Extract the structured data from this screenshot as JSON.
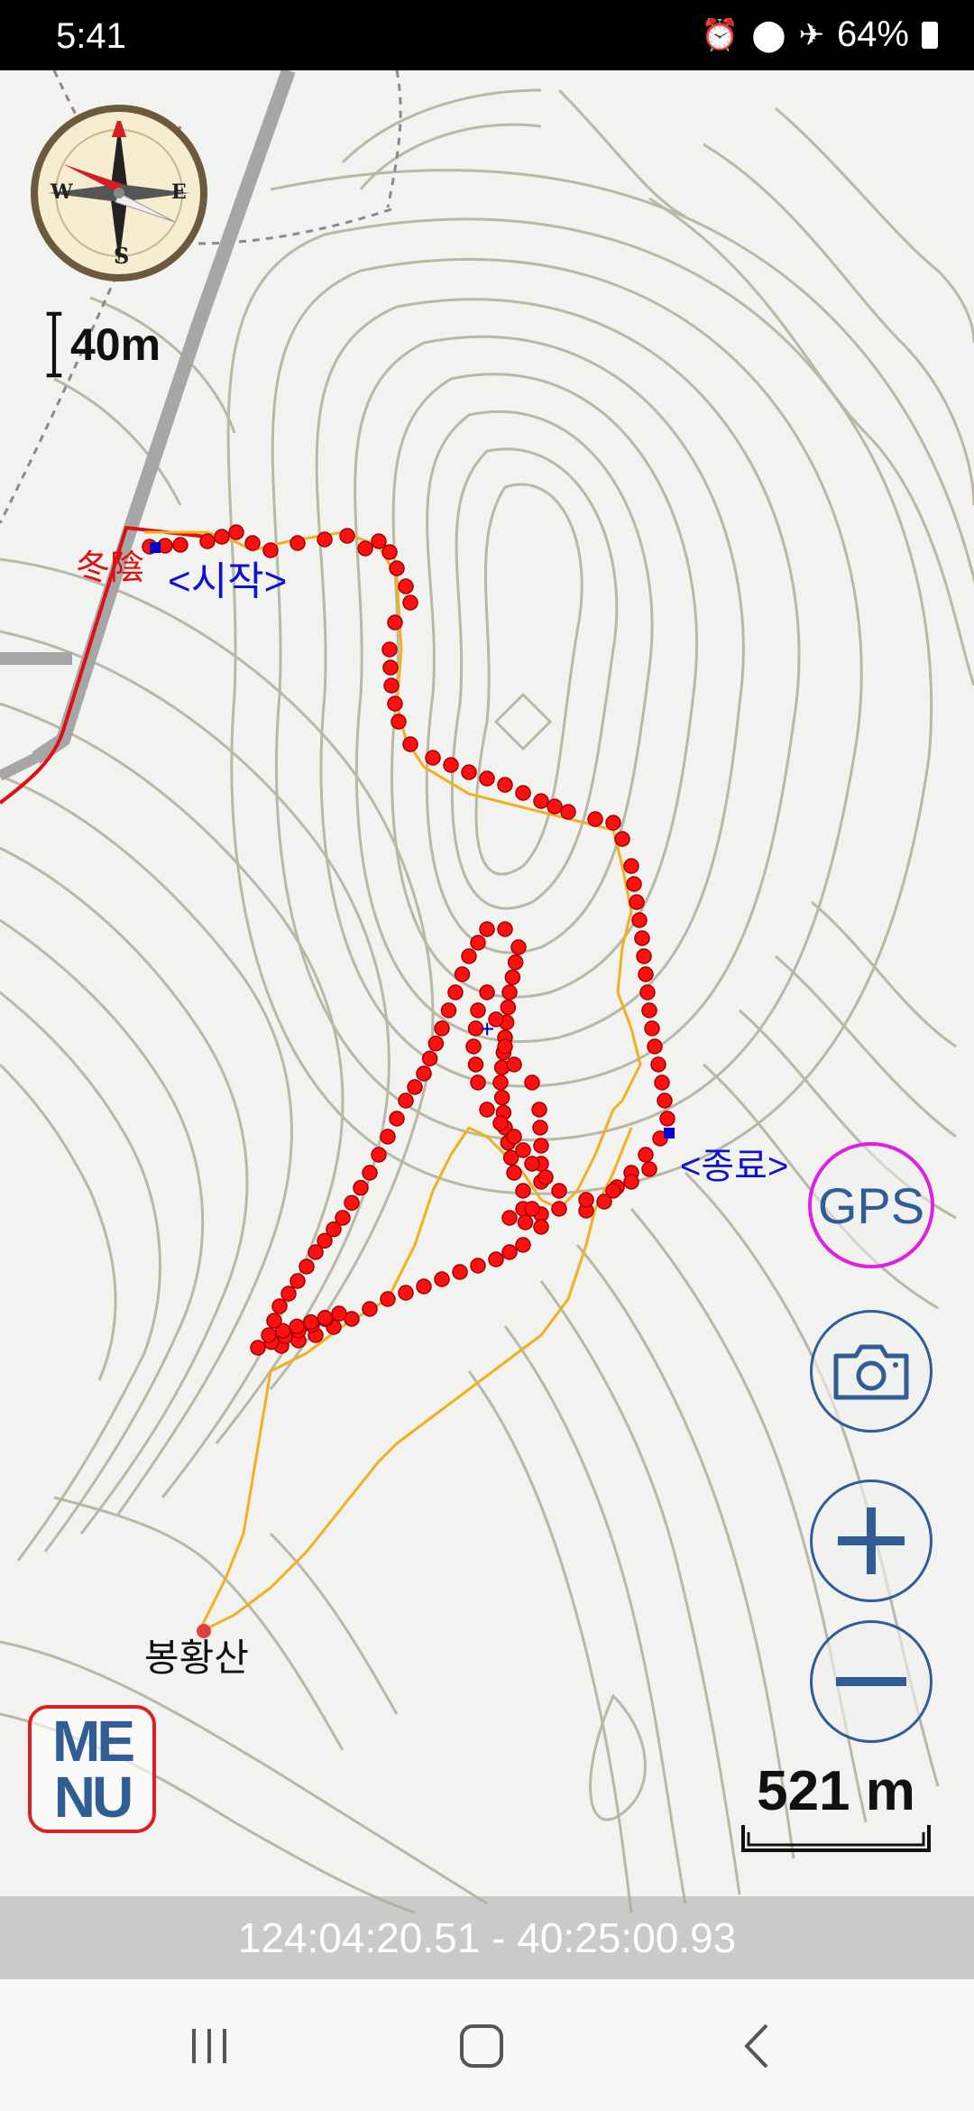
{
  "status": {
    "time": "5:41",
    "battery": "64%",
    "icons": [
      "alarm-icon",
      "location-icon",
      "airplane-icon",
      "battery-icon"
    ]
  },
  "map": {
    "labels": {
      "start_place": "冬陰",
      "start": "<시작>",
      "end": "<종료>",
      "peak": "봉황산"
    },
    "track_color": "#ff1010",
    "route_color": "#f0b020",
    "contour_color": "#b8b8a4"
  },
  "scale_small": "40m",
  "scale_large": "521 m",
  "buttons": {
    "gps": "GPS",
    "menu_line1": "ME",
    "menu_line2": "NU",
    "camera": "camera-icon",
    "zoom_in": "plus-icon",
    "zoom_out": "minus-icon"
  },
  "coordinates": "124:04:20.51 - 40:25:00.93",
  "nav": [
    "recent-apps-icon",
    "home-icon",
    "back-icon"
  ]
}
